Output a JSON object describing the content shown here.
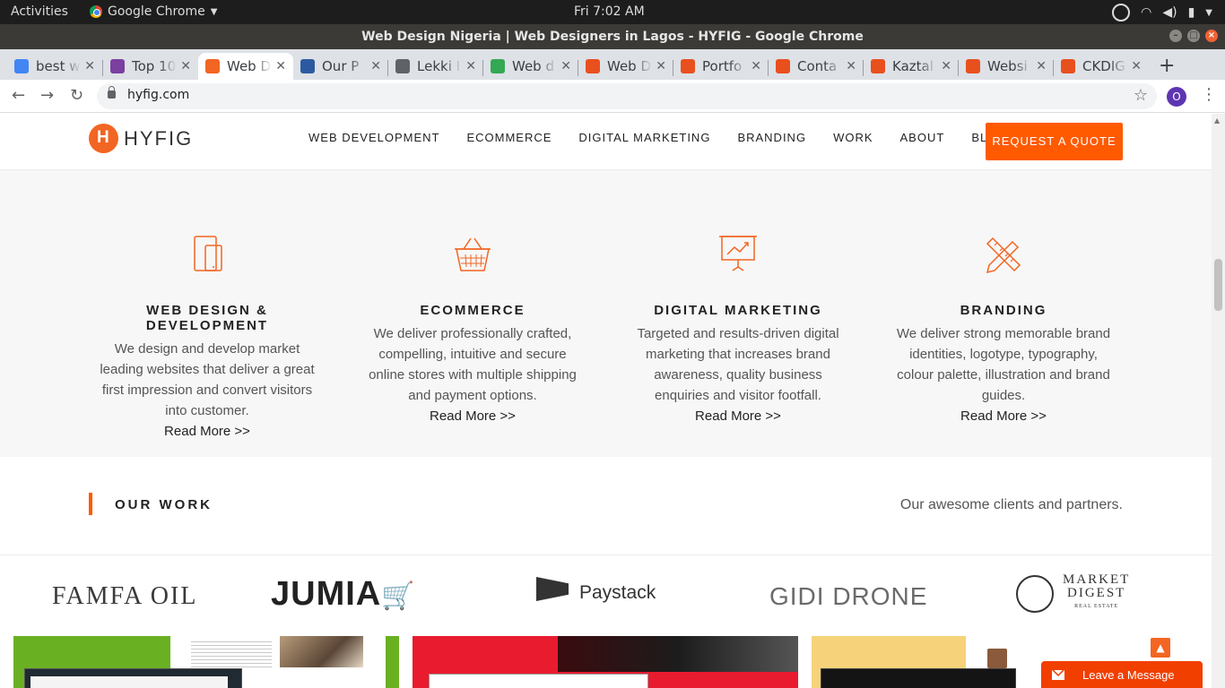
{
  "os": {
    "activities": "Activities",
    "app_name": "Google Chrome",
    "clock": "Fri  7:02 AM"
  },
  "window": {
    "title": "Web Design Nigeria | Web Designers in Lagos - HYFIG - Google Chrome"
  },
  "tabs": [
    {
      "label": "best w",
      "favicon": "google-icon",
      "color": "#4285f4"
    },
    {
      "label": "Top 10",
      "favicon": "rainbow-icon",
      "color": "#7b3fa0"
    },
    {
      "label": "Web D",
      "favicon": "hyfig-icon",
      "color": "#f26522"
    },
    {
      "label": "Our P",
      "favicon": "globe-flag-icon",
      "color": "#2c5aa0"
    },
    {
      "label": "Lekki I",
      "favicon": "world-icon",
      "color": "#5f6368"
    },
    {
      "label": "Web d",
      "favicon": "g-green-icon",
      "color": "#34a853"
    },
    {
      "label": "Web D",
      "favicon": "code-icon",
      "color": "#e8501e"
    },
    {
      "label": "Portfo",
      "favicon": "code-icon",
      "color": "#e8501e"
    },
    {
      "label": "Conta",
      "favicon": "code-icon",
      "color": "#e8501e"
    },
    {
      "label": "Kaztal",
      "favicon": "code-icon",
      "color": "#e8501e"
    },
    {
      "label": "Websi",
      "favicon": "code-icon",
      "color": "#e8501e"
    },
    {
      "label": "CKDIG",
      "favicon": "code-icon",
      "color": "#e8501e"
    }
  ],
  "omnibox": {
    "url": "hyfig.com",
    "profile_initial": "O"
  },
  "site": {
    "brand": "HYFIG",
    "nav": [
      "WEB DEVELOPMENT",
      "ECOMMERCE",
      "DIGITAL MARKETING",
      "BRANDING",
      "WORK",
      "ABOUT",
      "BLOG"
    ],
    "quote_button": "REQUEST A QUOTE",
    "accent": "#ff5a00"
  },
  "services": [
    {
      "icon": "devices-icon",
      "title": "WEB DESIGN & DEVELOPMENT",
      "desc": "We design and develop market leading websites that deliver a great first impression and convert visitors into customer.",
      "more": "Read More >>"
    },
    {
      "icon": "shopping-basket-icon",
      "title": "ECOMMERCE",
      "desc": "We deliver professionally crafted, compelling, intuitive and secure online stores with multiple shipping and payment options.",
      "more": "Read More >>"
    },
    {
      "icon": "presentation-chart-icon",
      "title": "DIGITAL MARKETING",
      "desc": "Targeted and results-driven digital marketing that increases brand awareness, quality business enquiries and visitor footfall.",
      "more": "Read More >>"
    },
    {
      "icon": "pencil-ruler-icon",
      "title": "BRANDING",
      "desc": "We deliver strong memorable brand identities, logotype, typography, colour palette, illustration and brand guides.",
      "more": "Read More >>"
    }
  ],
  "our_work": {
    "title": "OUR WORK",
    "tagline": "Our awesome clients and partners."
  },
  "clients": {
    "famfa": "FAMFA OIL",
    "jumia": "JUMIA",
    "paystack": "Paystack",
    "gidi": "GIDI DRONE",
    "market_top": "MARKET",
    "market_bottom": "DIGEST",
    "market_sub": "REAL ESTATE"
  },
  "chat": {
    "label": "Leave a Message"
  }
}
